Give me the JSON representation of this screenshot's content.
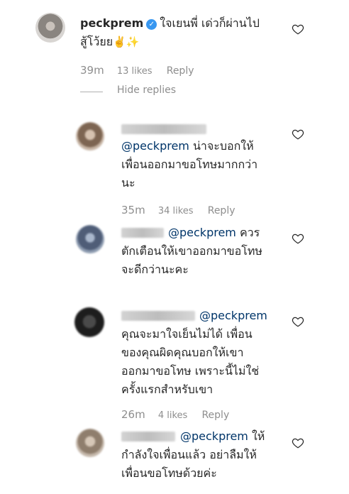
{
  "main_comment": {
    "username": "peckprem",
    "text_line1": "ใจเยนพี่ เด่วก็ผ่านไป",
    "text_line2": "สู้โว้ยย",
    "emojis": "✌️✨",
    "time": "39m",
    "likes": "13 likes",
    "reply": "Reply"
  },
  "hide_replies": "Hide replies",
  "replies": [
    {
      "mention": "@peckprem",
      "line1_rest": " น่าจะบอกให้",
      "line2": "เพื่อนออกมาขอโทษมากกว่า",
      "line3": "นะ",
      "time": "35m",
      "likes": "34 likes",
      "reply": "Reply"
    },
    {
      "mention": "@peckprem",
      "line1_rest": " ควร",
      "line2": "ตักเตือนให้เขาออกมาขอโทษ",
      "line3": "จะดีกว่านะคะ"
    },
    {
      "mention": "@peckprem",
      "line2": "คุณจะมาใจเย็นไม่ได้ เพื่อน",
      "line3": "ของคุณผิดคุณบอกให้เขา",
      "line4": "ออกมาขอโทษ เพราะนี้ไม่ใช่",
      "line5": "ครั้งแรกสำหรับเขา",
      "time": "26m",
      "likes": "4 likes",
      "reply": "Reply"
    },
    {
      "mention": "@peckprem",
      "line1_rest": " ให้",
      "line2": "กำลังใจเพื่อนแล้ว อย่าลืมให้",
      "line3": "เพื่อนขอโทษด้วยค่ะ"
    }
  ],
  "icons": {
    "heart": "heart-icon",
    "verified": "verified-badge-icon"
  },
  "colors": {
    "mention": "#003569",
    "meta": "#8e8e8e",
    "verified": "#3897f0"
  }
}
